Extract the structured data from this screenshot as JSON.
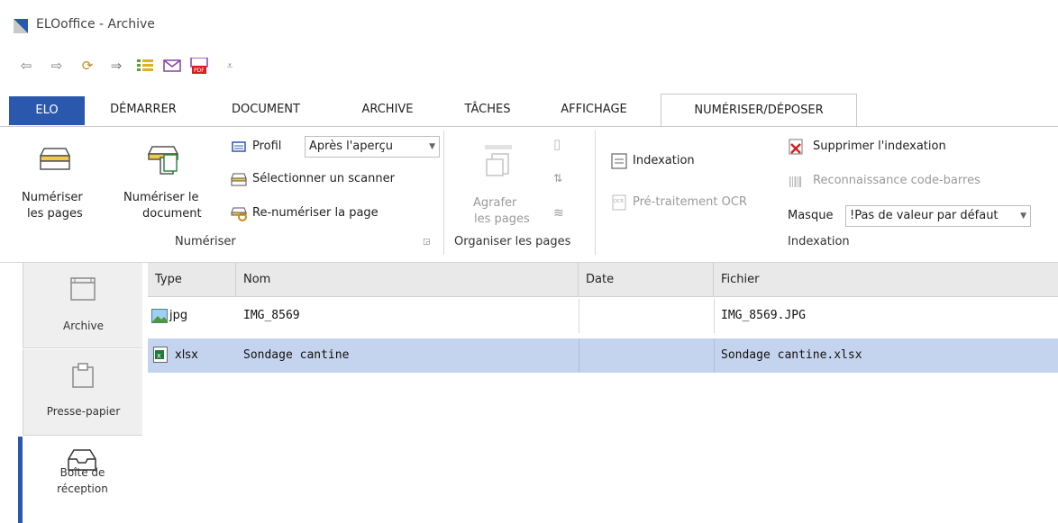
{
  "window": {
    "title": "ELOoffice - Archive"
  },
  "qat": {
    "icons": [
      "back-arrow-icon",
      "forward-arrow-icon",
      "sync-icon",
      "forward-small-icon",
      "checklist-icon",
      "mail-icon",
      "pdf-mail-icon",
      "customize-icon"
    ]
  },
  "tabs": {
    "elo": "ELO",
    "demarrer": "DÉMARRER",
    "document": "DOCUMENT",
    "archive": "ARCHIVE",
    "taches": "TÂCHES",
    "affichage": "AFFICHAGE",
    "numeriser": "NUMÉRISER/DÉPOSER"
  },
  "ribbon": {
    "numeriser_pages_l1": "Numériser",
    "numeriser_pages_l2": "les pages",
    "numeriser_doc_l1": "Numériser le",
    "numeriser_doc_l2": "document",
    "profil_label": "Profil",
    "profil_value": "Après l'aperçu",
    "select_scanner": "Sélectionner un scanner",
    "renumeriser": "Re-numériser la page",
    "group_numeriser": "Numériser",
    "agrafer_l1": "Agrafer",
    "agrafer_l2": "les pages",
    "group_organiser": "Organiser les pages",
    "indexation_btn": "Indexation",
    "ocr": "Pré-traitement OCR",
    "supprimer_index": "Supprimer l'indexation",
    "barcode": "Reconnaissance code-barres",
    "masque_label": "Masque",
    "masque_value": "!Pas de valeur par défaut",
    "group_indexation": "Indexation"
  },
  "sidebar": {
    "archive": "Archive",
    "presse": "Presse-papier",
    "inbox_l1": "Boîte de",
    "inbox_l2": "réception"
  },
  "list": {
    "headers": {
      "type": "Type",
      "nom": "Nom",
      "date": "Date",
      "fichier": "Fichier"
    },
    "rows": [
      {
        "type": "jpg",
        "nom": "IMG_8569",
        "date": "",
        "fichier": "IMG_8569.JPG"
      },
      {
        "type": "xlsx",
        "nom": "Sondage cantine",
        "date": "",
        "fichier": "Sondage cantine.xlsx"
      }
    ]
  },
  "colors": {
    "accent": "#2a58ae",
    "selection": "#c5d4ee"
  }
}
